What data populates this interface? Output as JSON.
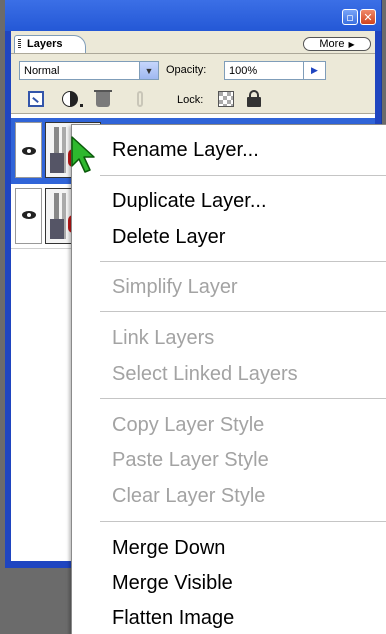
{
  "panel": {
    "tabs": [
      {
        "label": "Layers"
      }
    ],
    "more_button": {
      "label": "More",
      "icon": "triangle-right-icon"
    },
    "window_buttons": [
      {
        "name": "minimize",
        "icon": "minimize-icon",
        "glyph": "▫"
      },
      {
        "name": "close",
        "icon": "close-icon",
        "glyph": "✕"
      }
    ],
    "blend_mode": {
      "value": "Normal"
    },
    "opacity": {
      "label": "Opacity:",
      "value": "100%"
    },
    "toolbar": {
      "icons": [
        "new-layer-icon",
        "adjustment-layer-icon",
        "trash-icon",
        "link-icon"
      ],
      "lock_label": "Lock:",
      "lock_icons": [
        "lock-transparency-icon",
        "lock-all-icon"
      ]
    },
    "layers": [
      {
        "visible": true,
        "selected": true
      },
      {
        "visible": true,
        "selected": false
      }
    ]
  },
  "context_menu": {
    "items": [
      {
        "label": "Rename Layer...",
        "enabled": true
      },
      {
        "label": "Duplicate Layer...",
        "enabled": true
      },
      {
        "label": "Delete Layer",
        "enabled": true
      },
      {
        "label": "Simplify Layer",
        "enabled": false
      },
      {
        "label": "Link Layers",
        "enabled": false
      },
      {
        "label": "Select Linked Layers",
        "enabled": false
      },
      {
        "label": "Copy Layer Style",
        "enabled": false
      },
      {
        "label": "Paste Layer Style",
        "enabled": false
      },
      {
        "label": "Clear Layer Style",
        "enabled": false
      },
      {
        "label": "Merge Down",
        "enabled": true
      },
      {
        "label": "Merge Visible",
        "enabled": true
      },
      {
        "label": "Flatten Image",
        "enabled": true
      }
    ]
  },
  "colors": {
    "window_blue": "#1f45c0",
    "selection_blue": "#3064d8",
    "panel_bg": "#ece9d8",
    "disabled_text": "#a3a3a3",
    "cursor_green": "#2eb82e"
  }
}
